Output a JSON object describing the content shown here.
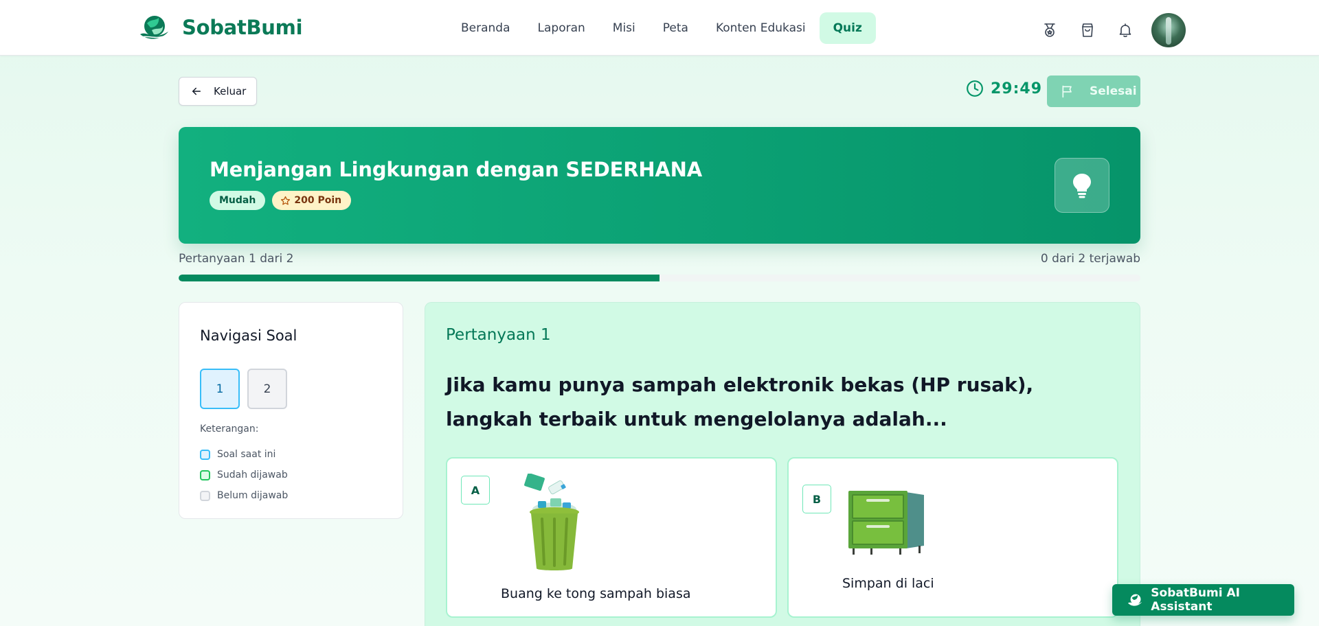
{
  "brand": {
    "name": "SobatBumi",
    "logo_icon": "globe-leaf-icon"
  },
  "nav": {
    "links": [
      "Beranda",
      "Laporan",
      "Misi",
      "Peta",
      "Konten Edukasi",
      "Quiz"
    ],
    "active": "Quiz",
    "icons": [
      "medal-icon",
      "shopping-bag-icon",
      "bell-icon"
    ]
  },
  "quiz_bar": {
    "exit_label": "Keluar",
    "timer": "29:49",
    "finish_label": "Selesai"
  },
  "quiz": {
    "title": "Menjangan Lingkungan dengan SEDERHANA",
    "difficulty": "Mudah",
    "points": "200 Poin",
    "hero_icon": "lightbulb-icon"
  },
  "progress": {
    "label": "Pertanyaan 1 dari 2",
    "answered_text": "0 dari 2 terjawab",
    "fraction": 0.5
  },
  "question_nav": {
    "title": "Navigasi Soal",
    "buttons": [
      "1",
      "2"
    ],
    "current": "1",
    "legend_title": "Keterangan:",
    "legend": [
      "Soal saat ini",
      "Sudah dijawab",
      "Belum dijawab"
    ]
  },
  "question": {
    "number_label": "Pertanyaan 1",
    "text": "Jika kamu punya sampah elektronik bekas (HP rusak), langkah terbaik untuk mengelolanya adalah...",
    "options": [
      {
        "letter": "A",
        "label": "Buang ke tong sampah biasa",
        "image": "trash-bin-image"
      },
      {
        "letter": "B",
        "label": "Simpan di laci",
        "image": "drawer-cabinet-image"
      }
    ]
  },
  "assistant": {
    "label": "SobatBumi AI Assistant"
  },
  "colors": {
    "primary": "#058a5e",
    "hero_start": "#12b07f",
    "hero_end": "#06946a",
    "active_nav_bg": "#d1fae5",
    "timer": "#059669",
    "finish_disabled": "#7fd3b3"
  }
}
